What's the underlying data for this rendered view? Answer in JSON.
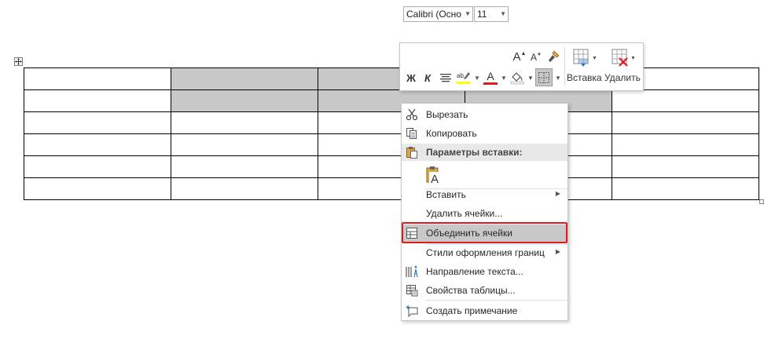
{
  "mini_toolbar": {
    "font_name": "Calibri (Осно",
    "font_size": "11",
    "grow_font_label": "A",
    "shrink_font_label": "A",
    "bold_label": "Ж",
    "italic_label": "К",
    "font_color_label": "A",
    "insert_label": "Вставка",
    "delete_label": "Удалить",
    "icons": [
      "format-painter-icon",
      "align-icon",
      "highlight-icon",
      "shading-icon",
      "borders-icon",
      "insert-table-icon",
      "delete-table-icon"
    ],
    "colors": {
      "highlight": "#ffff00",
      "font_color": "#e01a22"
    }
  },
  "context_menu": {
    "cut": "Вырезать",
    "copy": "Копировать",
    "paste_options": "Параметры вставки:",
    "insert": "Вставить",
    "delete_cells": "Удалить ячейки...",
    "merge_cells": "Объединить ячейки",
    "border_styles": "Стили оформления границ",
    "text_direction": "Направление текста...",
    "table_properties": "Свойства таблицы...",
    "new_comment": "Создать примечание"
  },
  "table": {
    "rows": 6,
    "cols": 5,
    "selected_cells": [
      [
        0,
        1
      ],
      [
        0,
        2
      ],
      [
        0,
        3
      ],
      [
        1,
        1
      ],
      [
        1,
        2
      ],
      [
        1,
        3
      ]
    ]
  },
  "colors": {
    "selection": "#c8c8c8",
    "highlight_border": "#e01a22"
  }
}
